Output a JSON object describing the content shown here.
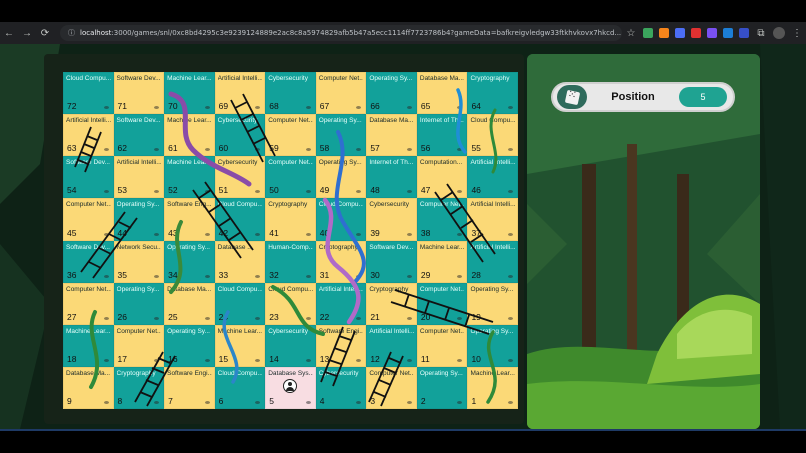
{
  "browser": {
    "url_host": "localhost",
    "url_rest": ":3000/games/snl/0xc8bd4295c3e9239124889e2ac8c8a5974829afb5b47a5ecc1114ff7723786b4?gameData=bafkreigvledgw33ftkhvkovx7hkcd..."
  },
  "status": {
    "position_label": "Position",
    "position_value": "5"
  },
  "board": {
    "rows": [
      [
        {
          "n": "72",
          "t": "Cloud Compu...",
          "c": "teal"
        },
        {
          "n": "71",
          "t": "Software Dev...",
          "c": "yellow"
        },
        {
          "n": "70",
          "t": "Machine Lear...",
          "c": "teal"
        },
        {
          "n": "69",
          "t": "Artificial Intelli...",
          "c": "yellow"
        },
        {
          "n": "68",
          "t": "Cybersecurity",
          "c": "teal"
        },
        {
          "n": "67",
          "t": "Computer Net...",
          "c": "yellow"
        },
        {
          "n": "66",
          "t": "Operating Sy...",
          "c": "teal"
        },
        {
          "n": "65",
          "t": "Database Ma...",
          "c": "yellow"
        },
        {
          "n": "64",
          "t": "Cryptography",
          "c": "teal"
        }
      ],
      [
        {
          "n": "63",
          "t": "Artificial Intelli...",
          "c": "yellow"
        },
        {
          "n": "62",
          "t": "Software Dev...",
          "c": "teal"
        },
        {
          "n": "61",
          "t": "Machine Lear...",
          "c": "yellow"
        },
        {
          "n": "60",
          "t": "Cybersecurity",
          "c": "teal"
        },
        {
          "n": "59",
          "t": "Computer Net...",
          "c": "yellow"
        },
        {
          "n": "58",
          "t": "Operating Sy...",
          "c": "teal"
        },
        {
          "n": "57",
          "t": "Database Ma...",
          "c": "yellow"
        },
        {
          "n": "56",
          "t": "Internet of Th...",
          "c": "teal"
        },
        {
          "n": "55",
          "t": "Cloud Compu...",
          "c": "yellow"
        }
      ],
      [
        {
          "n": "54",
          "t": "Software Dev...",
          "c": "teal"
        },
        {
          "n": "53",
          "t": "Artificial Intelli...",
          "c": "yellow"
        },
        {
          "n": "52",
          "t": "Machine Lear...",
          "c": "teal"
        },
        {
          "n": "51",
          "t": "Cybersecurity",
          "c": "yellow"
        },
        {
          "n": "50",
          "t": "Computer Net...",
          "c": "teal"
        },
        {
          "n": "49",
          "t": "Operating Sy...",
          "c": "yellow"
        },
        {
          "n": "48",
          "t": "Internet of Th...",
          "c": "teal"
        },
        {
          "n": "47",
          "t": "Computation...",
          "c": "yellow"
        },
        {
          "n": "46",
          "t": "Artificial Intelli...",
          "c": "teal"
        }
      ],
      [
        {
          "n": "45",
          "t": "Computer Net...",
          "c": "yellow"
        },
        {
          "n": "44",
          "t": "Operating Sy...",
          "c": "teal"
        },
        {
          "n": "43",
          "t": "Software Eng...",
          "c": "yellow"
        },
        {
          "n": "42",
          "t": "Cloud Compu...",
          "c": "teal"
        },
        {
          "n": "41",
          "t": "Cryptography",
          "c": "yellow"
        },
        {
          "n": "40",
          "t": "Cloud Compu...",
          "c": "teal"
        },
        {
          "n": "39",
          "t": "Cybersecurity",
          "c": "yellow"
        },
        {
          "n": "38",
          "t": "Computer Net...",
          "c": "teal"
        },
        {
          "n": "37",
          "t": "Artificial Intelli...",
          "c": "yellow"
        }
      ],
      [
        {
          "n": "36",
          "t": "Software Dev...",
          "c": "teal"
        },
        {
          "n": "35",
          "t": "Network Secu...",
          "c": "yellow"
        },
        {
          "n": "34",
          "t": "Operating Sy...",
          "c": "teal"
        },
        {
          "n": "33",
          "t": "Database ...",
          "c": "yellow"
        },
        {
          "n": "32",
          "t": "Human-Comp...",
          "c": "teal"
        },
        {
          "n": "31",
          "t": "Cryptography",
          "c": "yellow"
        },
        {
          "n": "30",
          "t": "Software Dev...",
          "c": "teal"
        },
        {
          "n": "29",
          "t": "Machine Lear...",
          "c": "yellow"
        },
        {
          "n": "28",
          "t": "Artificial Intelli...",
          "c": "teal"
        }
      ],
      [
        {
          "n": "27",
          "t": "Computer Net...",
          "c": "yellow"
        },
        {
          "n": "26",
          "t": "Operating Sy...",
          "c": "teal"
        },
        {
          "n": "25",
          "t": "Database Ma...",
          "c": "yellow"
        },
        {
          "n": "24",
          "t": "Cloud Compu...",
          "c": "teal"
        },
        {
          "n": "23",
          "t": "Cloud Compu...",
          "c": "yellow"
        },
        {
          "n": "22",
          "t": "Artificial Intelli...",
          "c": "teal"
        },
        {
          "n": "21",
          "t": "Cryptography",
          "c": "yellow"
        },
        {
          "n": "20",
          "t": "Computer Net...",
          "c": "teal"
        },
        {
          "n": "19",
          "t": "Operating Sy...",
          "c": "yellow"
        }
      ],
      [
        {
          "n": "18",
          "t": "Machine Lear...",
          "c": "teal"
        },
        {
          "n": "17",
          "t": "Computer Net...",
          "c": "yellow"
        },
        {
          "n": "16",
          "t": "Operating Sy...",
          "c": "teal"
        },
        {
          "n": "15",
          "t": "Machine Lear...",
          "c": "yellow"
        },
        {
          "n": "14",
          "t": "Cybersecurity",
          "c": "teal"
        },
        {
          "n": "13",
          "t": "Software Engi...",
          "c": "yellow"
        },
        {
          "n": "12",
          "t": "Artificial Intelli...",
          "c": "teal"
        },
        {
          "n": "11",
          "t": "Computer Net...",
          "c": "yellow"
        },
        {
          "n": "10",
          "t": "Operating Sy...",
          "c": "teal"
        }
      ],
      [
        {
          "n": "9",
          "t": "Database Ma...",
          "c": "yellow"
        },
        {
          "n": "8",
          "t": "Cryptography",
          "c": "teal"
        },
        {
          "n": "7",
          "t": "Software Engi...",
          "c": "yellow"
        },
        {
          "n": "6",
          "t": "Cloud Compu...",
          "c": "teal"
        },
        {
          "n": "5",
          "t": "Database Sys...",
          "c": "pink",
          "player": true
        },
        {
          "n": "4",
          "t": "Cybersecurity",
          "c": "teal"
        },
        {
          "n": "3",
          "t": "Computer Net...",
          "c": "yellow"
        },
        {
          "n": "2",
          "t": "Operating Sy...",
          "c": "teal"
        },
        {
          "n": "1",
          "t": "Machine Lear...",
          "c": "yellow"
        }
      ]
    ]
  },
  "icons": {
    "dice": "dice-icon",
    "player": "player-token-icon"
  },
  "colors": {
    "teal": "#12a19a",
    "yellow": "#fbd977",
    "pink": "#f8dde2",
    "position_badge": "#1fa392"
  }
}
